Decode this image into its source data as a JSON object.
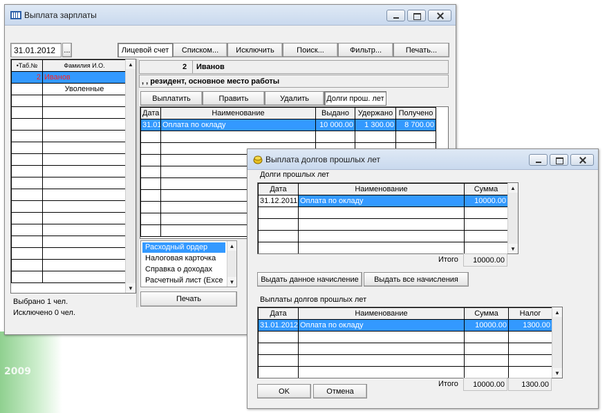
{
  "main": {
    "title": "Выплата зарплаты",
    "date_value": "31.01.2012",
    "date_button": "...",
    "tabs": {
      "account": "Лицевой счет",
      "list": "Списком...",
      "exclude": "Исключить",
      "search": "Поиск...",
      "filter": "Фильтр...",
      "print": "Печать..."
    },
    "employees": {
      "col_num": "•Таб.№",
      "col_name": "Фамилия И.О.",
      "row1_num": "2",
      "row1_name": "Иванов",
      "group_label": "Уволенные"
    },
    "selected_count": "Выбрано 1 чел.",
    "excluded_count": "Исключено 0 чел.",
    "person_num": "2",
    "person_name": "Иванов",
    "person_status": ", , резидент, основное место работы",
    "actions": {
      "pay": "Выплатить",
      "edit": "Править",
      "delete": "Удалить",
      "debts": "Долги прош. лет"
    },
    "payments": {
      "headers": [
        "Дата",
        "Наименование",
        "Выдано",
        "Удержано",
        "Получено"
      ],
      "row": [
        "31.01",
        "Оплата по окладу",
        "10 000.00",
        "1 300.00",
        "8 700.00"
      ]
    },
    "reports": [
      "Расходный ордер",
      "Налоговая карточка",
      "Справка о доходах",
      "Расчетный лист (Exce"
    ],
    "print_button": "Печать"
  },
  "dialog": {
    "title": "Выплата долгов прошлых лет",
    "debts_label": "Долги прошлых лет",
    "debts": {
      "headers": [
        "Дата",
        "Наименование",
        "Сумма"
      ],
      "row": [
        "31.12.2011",
        "Оплата по окладу",
        "10000.00"
      ]
    },
    "total_label": "Итого",
    "debts_total": "10000.00",
    "issue_selected": "Выдать данное начисление",
    "issue_all": "Выдать все начисления",
    "paid_label": "Выплаты долгов прошлых лет",
    "paid": {
      "headers": [
        "Дата",
        "Наименование",
        "Сумма",
        "Налог"
      ],
      "row": [
        "31.01.2012",
        "Оплата по окладу",
        "10000.00",
        "1300.00"
      ]
    },
    "paid_total_sum": "10000.00",
    "paid_total_tax": "1300.00",
    "ok": "OK",
    "cancel": "Отмена"
  },
  "desktop_year": "2009",
  "colors": {
    "selection": "#3399ff",
    "highlight_text": "#ff0000"
  }
}
